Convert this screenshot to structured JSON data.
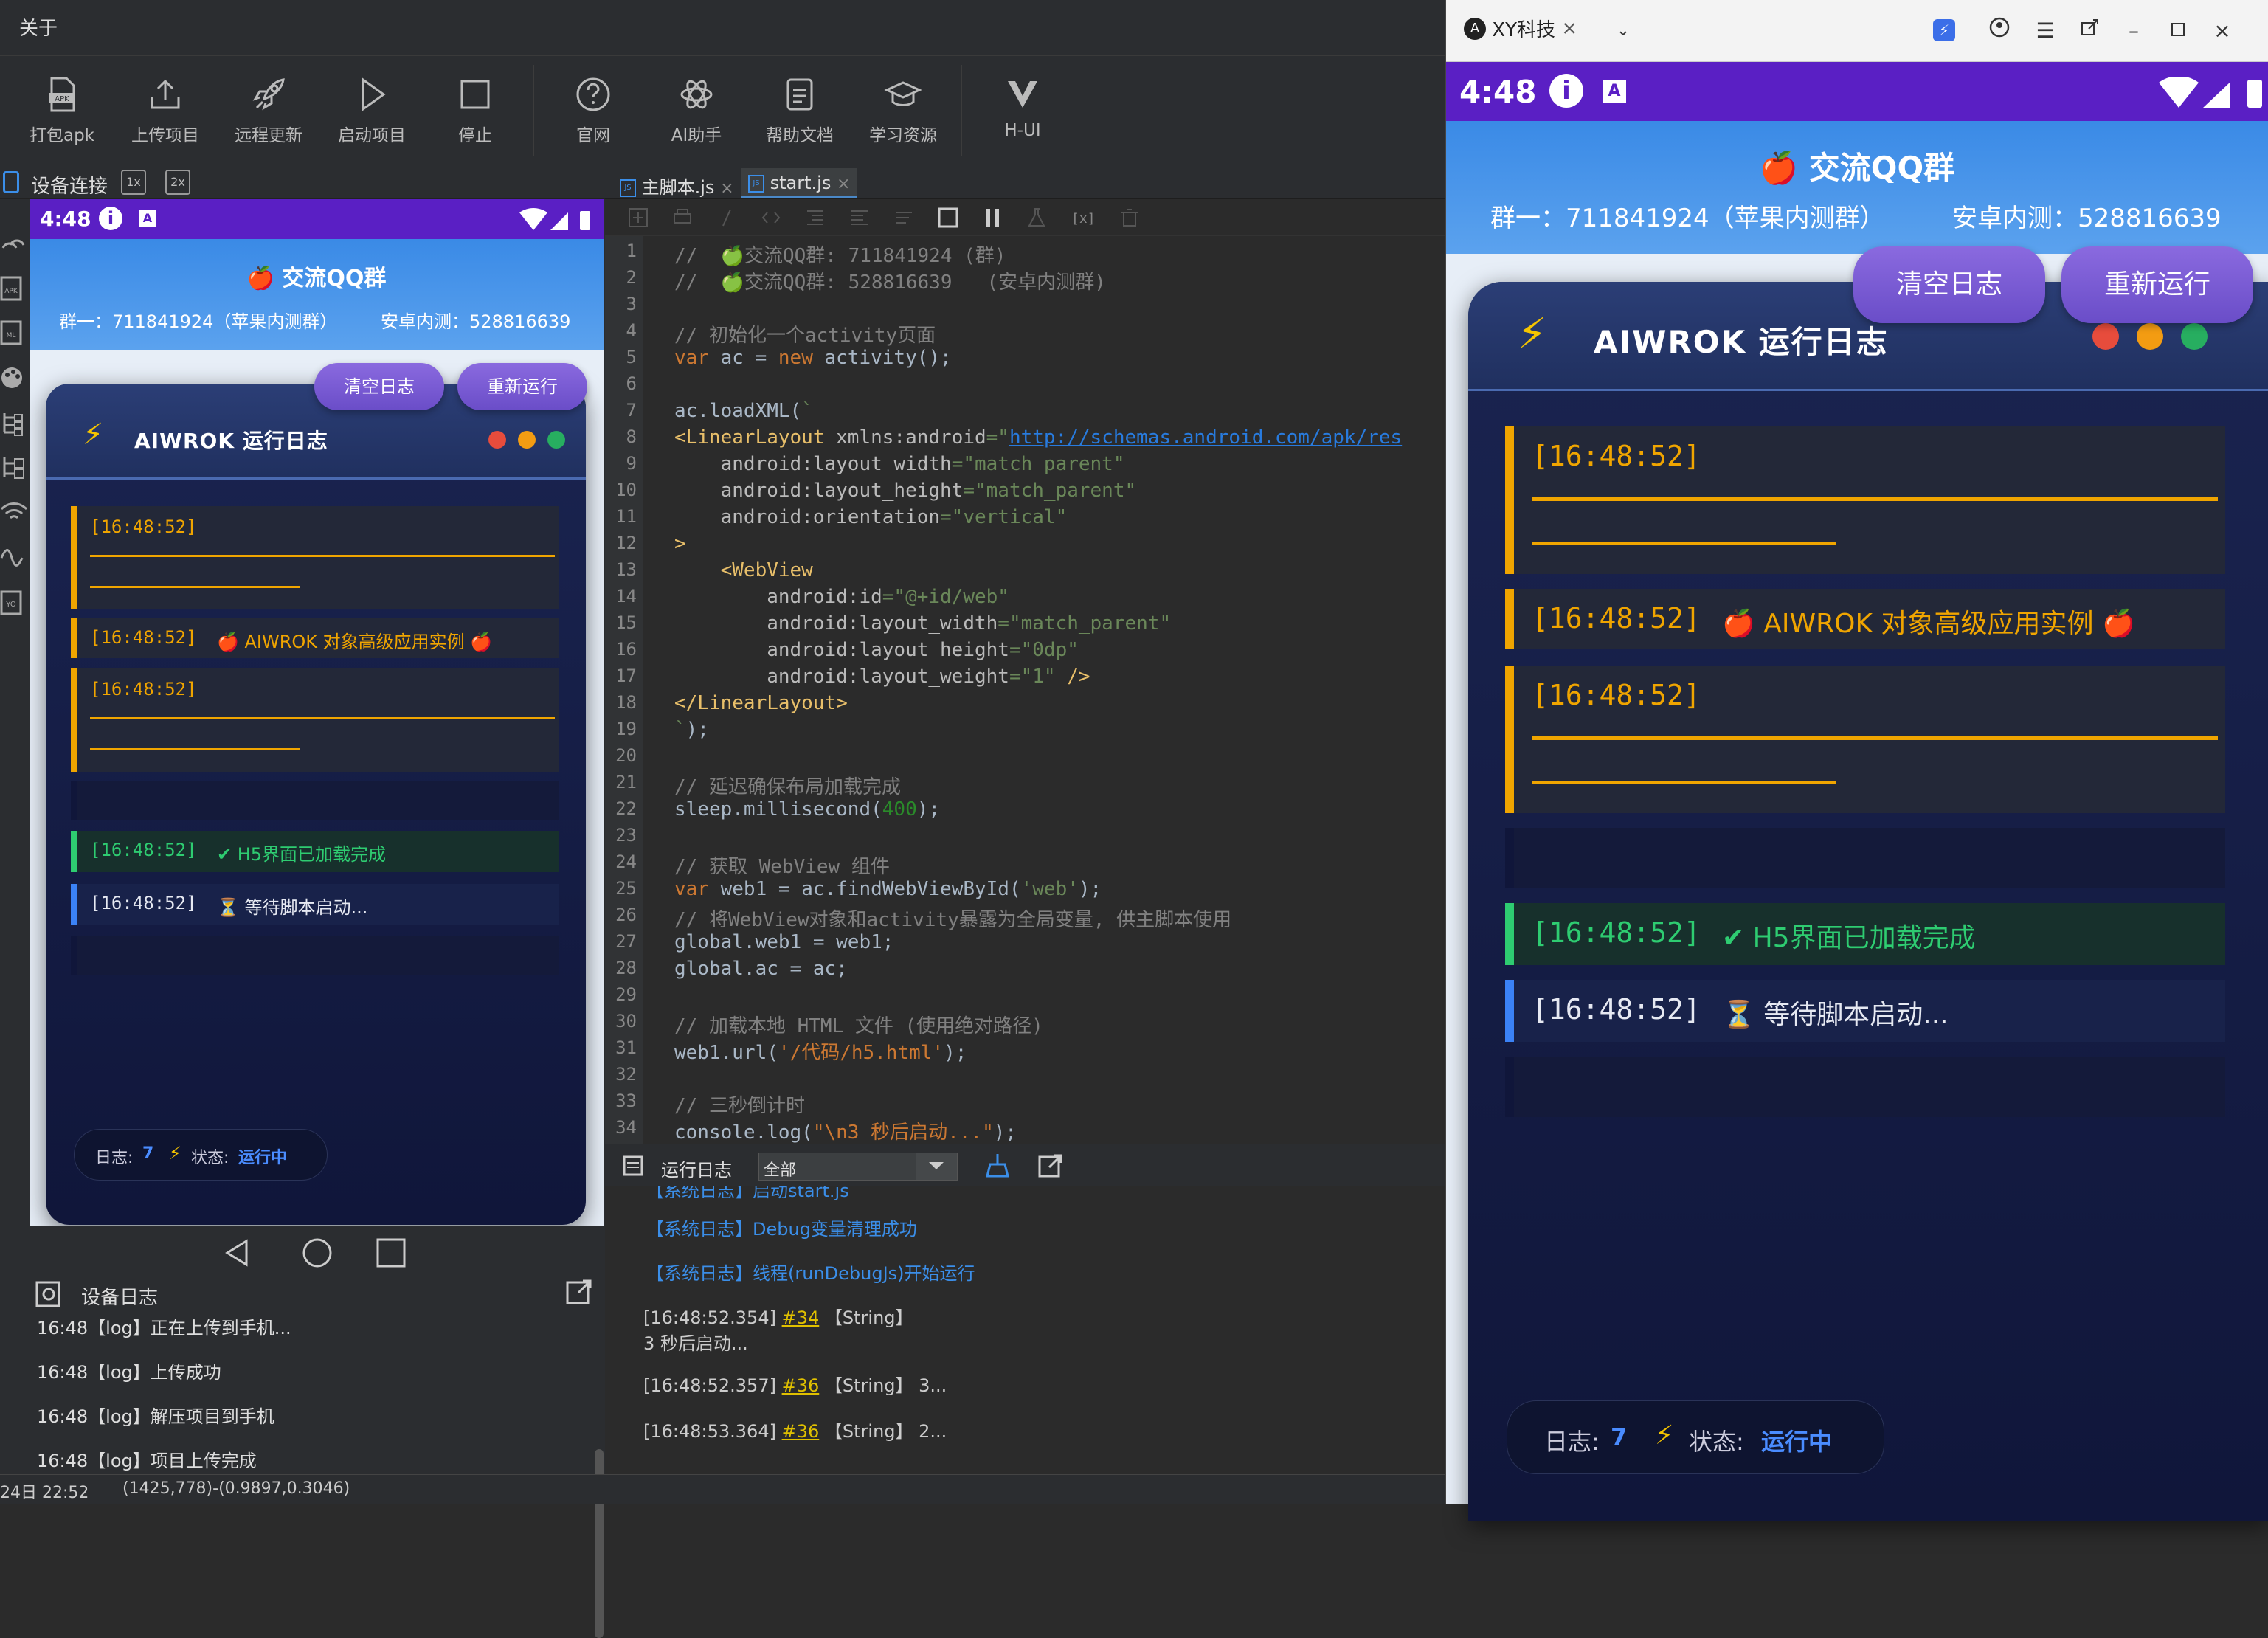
{
  "menu": {
    "about": "关于"
  },
  "toolbar": {
    "items": [
      {
        "label": "打包apk",
        "icon": "apk-icon"
      },
      {
        "label": "上传项目",
        "icon": "upload-icon"
      },
      {
        "label": "远程更新",
        "icon": "rocket-icon"
      },
      {
        "label": "启动项目",
        "icon": "play-icon"
      },
      {
        "label": "停止",
        "icon": "stop-icon"
      },
      {
        "label": "官网",
        "icon": "help-circle-icon"
      },
      {
        "label": "AI助手",
        "icon": "openai-icon"
      },
      {
        "label": "帮助文档",
        "icon": "document-icon"
      },
      {
        "label": "学习资源",
        "icon": "graduation-cap-icon"
      },
      {
        "label": "H-UI",
        "icon": "hui-logo-icon"
      }
    ]
  },
  "device_panel": {
    "title": "设备连接",
    "btn_1x": "1x",
    "btn_2x": "2x"
  },
  "phone": {
    "time": "4:48",
    "header_title": "🍎 交流QQ群",
    "group1": "群一：711841924（苹果内测群）",
    "group2": "安卓内测：528816639",
    "clear_log": "清空日志",
    "rerun": "重新运行",
    "log_title": "AIWROK 运行日志",
    "logs": [
      {
        "ts": "[16:48:52]",
        "text": ""
      },
      {
        "ts": "[16:48:52]",
        "text": "🍎 AIWROK 对象高级应用实例 🍎"
      },
      {
        "ts": "[16:48:52]",
        "text": ""
      },
      {
        "ts": "",
        "text": ""
      },
      {
        "ts": "[16:48:52]",
        "text": "✔ H5界面已加载完成"
      },
      {
        "ts": "[16:48:52]",
        "text": "⏳ 等待脚本启动..."
      },
      {
        "ts": "",
        "text": ""
      }
    ],
    "status_log_label": "日志:",
    "status_log_count": "7",
    "status_state_label": "状态:",
    "status_state_value": "运行中",
    "colors": {
      "status_bar": "#5a1fc4",
      "header": "#4a96ea",
      "accent_yellow": "#f0a500",
      "accent_green": "#2ecc71",
      "accent_blue": "#3b82f6",
      "dot_red": "#e74c3c",
      "dot_orange": "#f39c12",
      "dot_green": "#27ae60"
    }
  },
  "device_log": {
    "title": "设备日志",
    "lines": [
      "16:48【log】正在上传到手机...",
      "16:48【log】上传成功",
      "16:48【log】解压项目到手机",
      "16:48【log】项目上传完成"
    ]
  },
  "status_line": {
    "left": "24日 22:52",
    "coords": "(1425,778)-(0.9897,0.3046)"
  },
  "editor": {
    "tabs": [
      "主脚本.js",
      "start.js"
    ],
    "lines": [
      [
        [
          "c-cm",
          "//  🍏交流QQ群: 711841924 (群)"
        ]
      ],
      [
        [
          "c-cm",
          "//  🍏交流QQ群: 528816639   (安卓内测群)"
        ]
      ],
      [],
      [
        [
          "c-cm",
          "// 初始化一个activity页面"
        ]
      ],
      [
        [
          "c-kw",
          "var"
        ],
        [
          "c-tx",
          " ac = "
        ],
        [
          "c-kw",
          "new"
        ],
        [
          "c-tx",
          " activity();"
        ]
      ],
      [],
      [
        [
          "c-tx",
          "ac.loadXML("
        ],
        [
          "c-st",
          "`"
        ]
      ],
      [
        [
          "c-tg",
          "<LinearLayout "
        ],
        [
          "c-at",
          "xmlns:android"
        ],
        [
          "c-av",
          "=\""
        ],
        [
          "c-lk",
          "http://schemas.android.com/apk/res"
        ]
      ],
      [
        [
          "c-at",
          "    android:layout_width"
        ],
        [
          "c-av",
          "=\"match_parent\""
        ]
      ],
      [
        [
          "c-at",
          "    android:layout_height"
        ],
        [
          "c-av",
          "=\"match_parent\""
        ]
      ],
      [
        [
          "c-at",
          "    android:orientation"
        ],
        [
          "c-av",
          "=\"vertical\""
        ]
      ],
      [
        [
          "c-tg",
          ">"
        ]
      ],
      [
        [
          "c-tg",
          "    <WebView"
        ]
      ],
      [
        [
          "c-at",
          "        android:id"
        ],
        [
          "c-av",
          "=\"@+id/web\""
        ]
      ],
      [
        [
          "c-at",
          "        android:layout_width"
        ],
        [
          "c-av",
          "=\"match_parent\""
        ]
      ],
      [
        [
          "c-at",
          "        android:layout_height"
        ],
        [
          "c-av",
          "=\"0dp\""
        ]
      ],
      [
        [
          "c-at",
          "        android:layout_weight"
        ],
        [
          "c-av",
          "=\"1\""
        ],
        [
          "c-tg",
          " />"
        ]
      ],
      [
        [
          "c-tg",
          "</LinearLayout>"
        ]
      ],
      [
        [
          "c-st",
          "`"
        ],
        [
          "c-tx",
          ");"
        ]
      ],
      [],
      [
        [
          "c-cm",
          "// 延迟确保布局加载完成"
        ]
      ],
      [
        [
          "c-tx",
          "sleep.millisecond("
        ],
        [
          "c-num",
          "400"
        ],
        [
          "c-tx",
          ");"
        ]
      ],
      [],
      [
        [
          "c-cm",
          "// 获取 WebView 组件"
        ]
      ],
      [
        [
          "c-kw",
          "var"
        ],
        [
          "c-tx",
          " web1 = ac.findWebViewById("
        ],
        [
          "c-st",
          "'web'"
        ],
        [
          "c-tx",
          ");"
        ]
      ],
      [
        [
          "c-cm",
          "// 将WebView对象和activity暴露为全局变量, 供主脚本使用"
        ]
      ],
      [
        [
          "c-tx",
          "global.web1 = web1;"
        ]
      ],
      [
        [
          "c-tx",
          "global.ac = ac;"
        ]
      ],
      [],
      [
        [
          "c-cm",
          "// 加载本地 HTML 文件 (使用绝对路径)"
        ]
      ],
      [
        [
          "c-tx",
          "web1.url("
        ],
        [
          "c-cr",
          "'/代码/h5.html'"
        ],
        [
          "c-tx",
          ");"
        ]
      ],
      [],
      [
        [
          "c-cm",
          "// 三秒倒计时"
        ]
      ],
      [
        [
          "c-tx",
          "console.log("
        ],
        [
          "c-cr",
          "\"\\n3 秒后启动...\""
        ],
        [
          "c-tx",
          ");"
        ]
      ]
    ]
  },
  "run_log": {
    "title": "运行日志",
    "filter": "全部",
    "lines": [
      {
        "kind": "sys",
        "text": "【系统日志】启动start.js"
      },
      {
        "kind": "sys",
        "text": "【系统日志】Debug变量清理成功"
      },
      {
        "kind": "sys",
        "text": "【系统日志】线程(runDebugJs)开始运行"
      },
      {
        "kind": "log",
        "ts": "[16:48:52.354]",
        "ref": "#34",
        "type": "【String】",
        "text": "3 秒后启动..."
      },
      {
        "kind": "log",
        "ts": "[16:48:52.357]",
        "ref": "#36",
        "type": "【String】",
        "text": "3..."
      },
      {
        "kind": "log",
        "ts": "[16:48:53.364]",
        "ref": "#36",
        "type": "【String】",
        "text": "2..."
      }
    ]
  },
  "right_window": {
    "tab_title": "XY科技"
  }
}
